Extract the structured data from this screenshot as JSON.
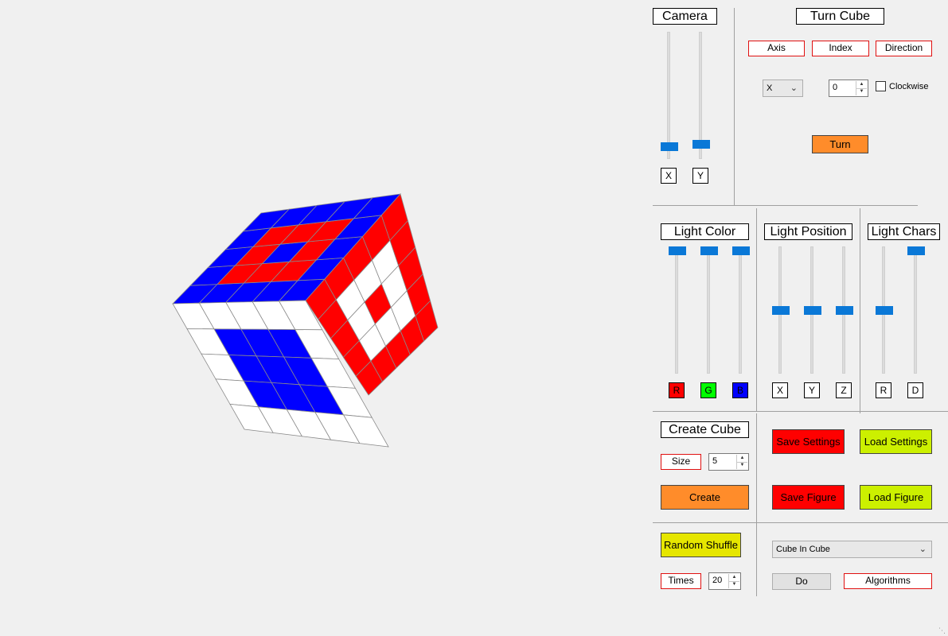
{
  "cube": {
    "size": 5,
    "orientation": "isometric"
  },
  "camera": {
    "title": "Camera",
    "x_label": "X",
    "y_label": "Y",
    "x_value": 0.12,
    "y_value": 0.11
  },
  "turn_cube": {
    "title": "Turn Cube",
    "axis_label": "Axis",
    "index_label": "Index",
    "direction_label": "Direction",
    "axis_value": "X",
    "index_value": "0",
    "clockwise_label": "Clockwise",
    "clockwise_checked": false,
    "turn_button": "Turn"
  },
  "light_color": {
    "title": "Light Color",
    "r_label": "R",
    "g_label": "G",
    "b_label": "B",
    "r_value": 1.0,
    "g_value": 1.0,
    "b_value": 1.0,
    "colors": {
      "r": "#ff0000",
      "g": "#00ff00",
      "b": "#0000ff"
    }
  },
  "light_position": {
    "title": "Light Position",
    "x_label": "X",
    "y_label": "Y",
    "z_label": "Z",
    "x_value": 0.5,
    "y_value": 0.5,
    "z_value": 0.5
  },
  "light_chars": {
    "title": "Light Chars",
    "r_label": "R",
    "d_label": "D",
    "r_value": 0.5,
    "d_value": 1.0
  },
  "create_cube": {
    "title": "Create Cube",
    "size_label": "Size",
    "size_value": "5",
    "create_button": "Create"
  },
  "settings": {
    "save_settings": "Save Settings",
    "load_settings": "Load Settings",
    "save_figure": "Save Figure",
    "load_figure": "Load Figure"
  },
  "shuffle": {
    "button": "Random Shuffle",
    "times_label": "Times",
    "times_value": "20"
  },
  "algorithms": {
    "selected": "Cube In Cube",
    "do_button": "Do",
    "algorithms_button": "Algorithms"
  },
  "colors": {
    "red": "#ff0000",
    "blue": "#0000ff",
    "white": "#ffffff",
    "orange": "#ff8c2a",
    "yellow": "#e6e600",
    "lime": "#ccf000",
    "slider": "#0a78d7"
  }
}
